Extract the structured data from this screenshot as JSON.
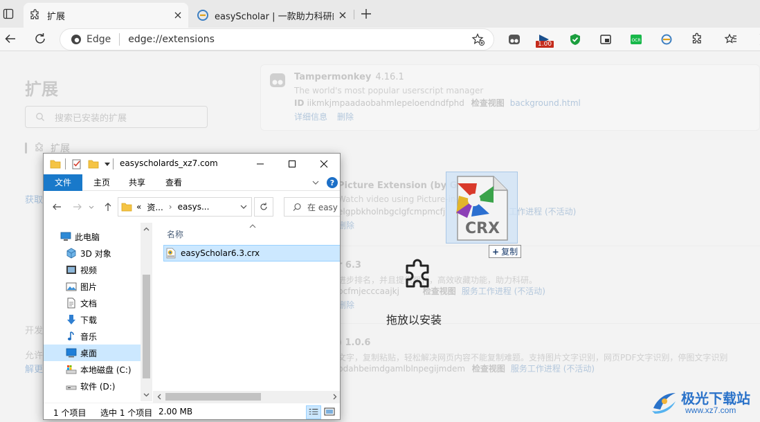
{
  "browser": {
    "tabs": [
      {
        "title": "扩展",
        "active": true
      },
      {
        "title": "easyScholar | 一款助力科研的浏览",
        "active": false
      }
    ],
    "address": {
      "brand": "Edge",
      "url": "edge://extensions"
    },
    "toolbar_badge": "1.00"
  },
  "extensions_page": {
    "title": "扩展",
    "search_placeholder": "搜索已安装的扩展",
    "sidebar_item": "扩展",
    "faint_items": [
      "开发",
      "允许"
    ],
    "faint_links": [
      "获取",
      "解更"
    ],
    "cards": [
      {
        "name": "Tampermonkey",
        "version": "4.16.1",
        "description": "The world's most popular userscript manager",
        "meta_label": "ID",
        "meta_id": "iikmkjmpaadaobahmlepeloendndfphd",
        "meta_inspect": "检查视图",
        "meta_link": "background.html",
        "actions": [
          "详细信息",
          "删除"
        ]
      },
      {
        "name": "Picture Extension (by Google)",
        "version": "",
        "description": "Watch video using Picture-in-Picture",
        "meta_label": "",
        "meta_id": "elgpbkholnbgclgfcmpmcfj",
        "meta_inspect": "",
        "meta_link": "务工作进程 (不活动)",
        "actions": [
          "删除"
        ]
      },
      {
        "name": "r 6.3",
        "version": "",
        "description": "进步排名，并且提供期刊，高效收藏功能，助力科研。",
        "meta_label": "",
        "meta_id": "pcfmjecccaajkj",
        "meta_inspect": "检查视图",
        "meta_link": "服务工作进程 (不活动)",
        "actions": [
          "删除"
        ]
      },
      {
        "name": ") 1.0.6",
        "version": "",
        "description": "文字，复制粘贴，轻松解决网页内容不能复制难题。支持图片文字识别，网页PDF文字识别，停图文字识别",
        "meta_label": "",
        "meta_id": "pdahbeimdgamlblnpegijmdem",
        "meta_inspect": "检查视图",
        "meta_link": "服务工作进程 (不活动)",
        "actions": []
      }
    ]
  },
  "drop_overlay": {
    "text": "拖放以安装",
    "drag_file_label": "CRX",
    "copy_tip": "复制"
  },
  "explorer": {
    "title": "easyscholards_xz7.com",
    "ribbon_tabs": [
      "文件",
      "主页",
      "共享",
      "查看"
    ],
    "path_segments": [
      "资...",
      "easys..."
    ],
    "path_prefix": "«",
    "search_placeholder": "在 easy",
    "nav_items": [
      {
        "label": "此电脑",
        "icon": "pc-icon"
      },
      {
        "label": "3D 对象",
        "icon": "3d-objects-icon"
      },
      {
        "label": "视频",
        "icon": "video-icon"
      },
      {
        "label": "图片",
        "icon": "pictures-icon"
      },
      {
        "label": "文档",
        "icon": "documents-icon"
      },
      {
        "label": "下载",
        "icon": "downloads-icon"
      },
      {
        "label": "音乐",
        "icon": "music-icon"
      },
      {
        "label": "桌面",
        "icon": "desktop-icon",
        "selected": true
      },
      {
        "label": "本地磁盘 (C:)",
        "icon": "local-disk-icon"
      },
      {
        "label": "软件 (D:)",
        "icon": "drive-icon"
      }
    ],
    "column_name": "名称",
    "files": [
      {
        "name": "easyScholar6.3.crx",
        "selected": true
      }
    ],
    "status": {
      "items": "1 个项目",
      "selected": "选中 1 个项目",
      "size": "2.00 MB"
    }
  },
  "watermark": {
    "cn": "极光下载站",
    "en": "www.xz7.com"
  }
}
